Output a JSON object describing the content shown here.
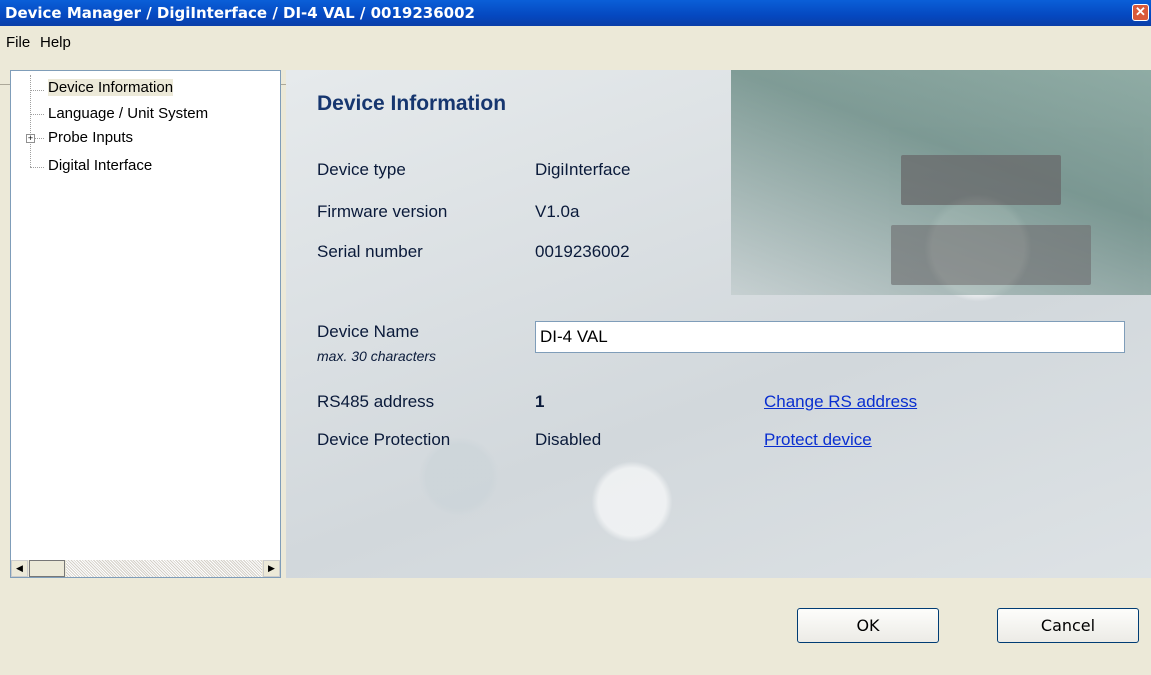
{
  "window": {
    "title": "Device Manager / DigiInterface / DI-4 VAL / 0019236002",
    "close_glyph": "✕"
  },
  "menu": {
    "file": "File",
    "help": "Help"
  },
  "tree": {
    "items": [
      {
        "label": "Device Information",
        "selected": true
      },
      {
        "label": "Language / Unit System"
      },
      {
        "label": "Probe Inputs",
        "expander": "+"
      },
      {
        "label": "Digital Interface"
      }
    ],
    "scroll_left": "◀",
    "scroll_right": "▶"
  },
  "main": {
    "title": "Device Information",
    "device_type": {
      "label": "Device type",
      "value": "DigiInterface"
    },
    "firmware": {
      "label": "Firmware version",
      "value": "V1.0a"
    },
    "serial": {
      "label": "Serial number",
      "value": "0019236002"
    },
    "device_name": {
      "label": "Device Name",
      "hint": "max. 30 characters",
      "value": "DI-4 VAL"
    },
    "rs485": {
      "label": "RS485 address",
      "value": "1",
      "link": "Change RS address"
    },
    "protection": {
      "label": "Device Protection",
      "value": "Disabled",
      "link": "Protect device"
    }
  },
  "buttons": {
    "ok": "OK",
    "cancel": "Cancel"
  }
}
